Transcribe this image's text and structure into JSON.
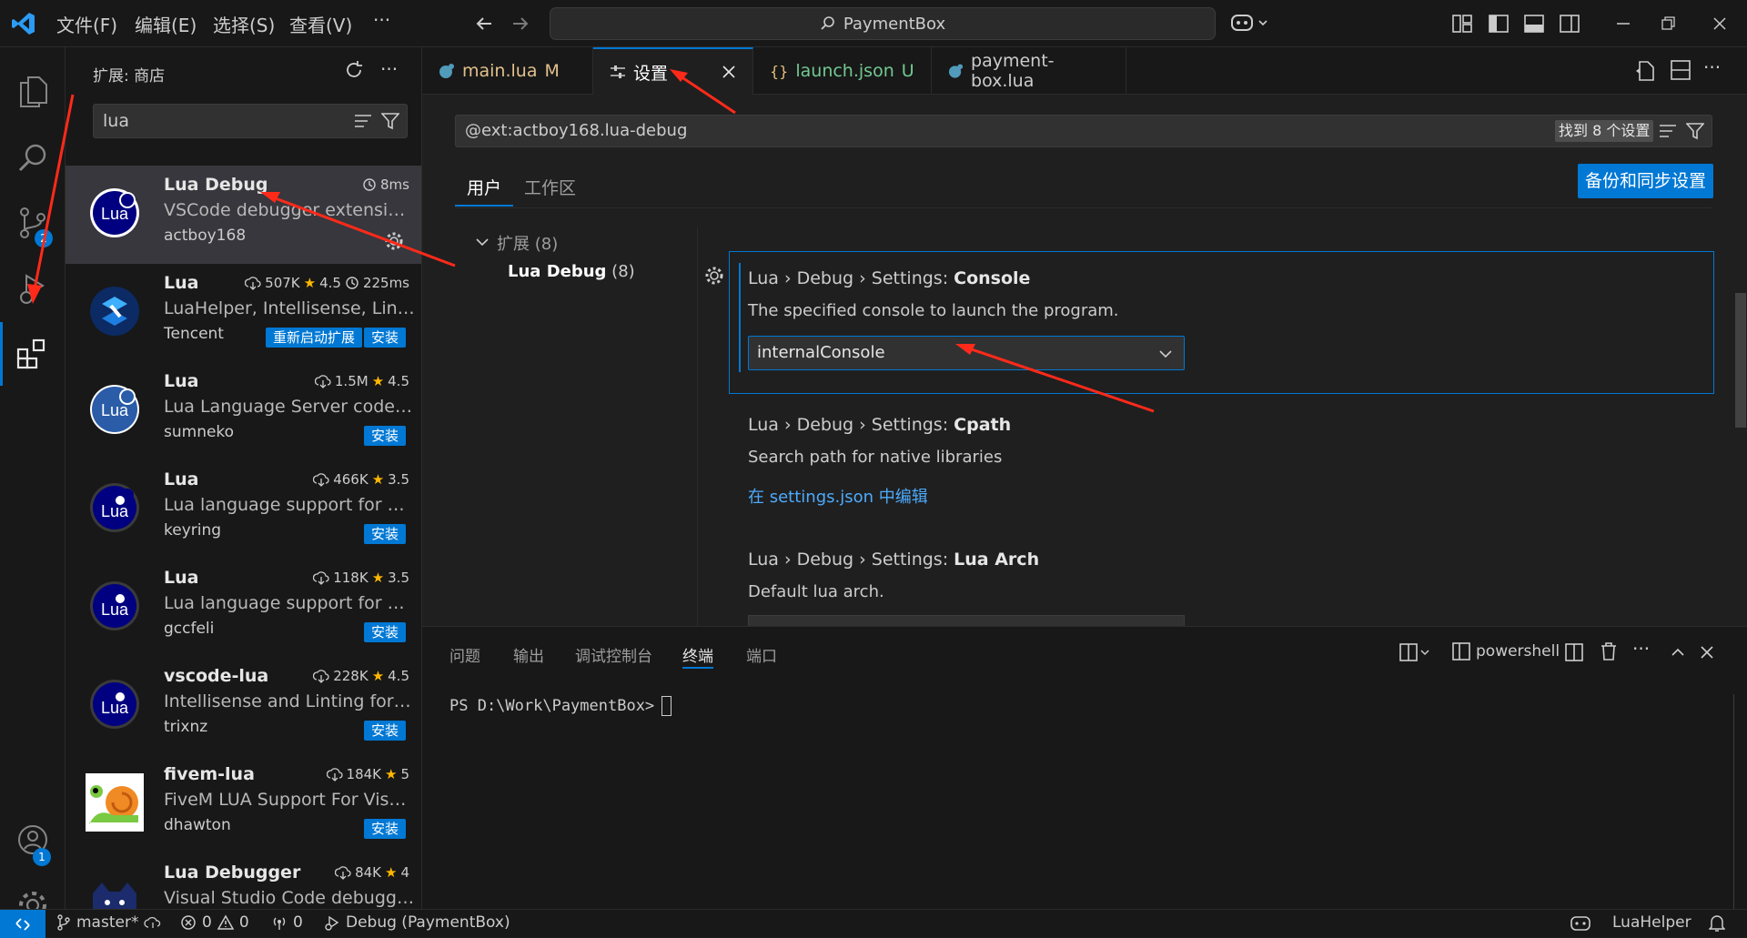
{
  "titlebar": {
    "menu": [
      "文件(F)",
      "编辑(E)",
      "选择(S)",
      "查看(V)"
    ],
    "more": "···",
    "command_center": "PaymentBox"
  },
  "activity": {
    "scm_badge": "2",
    "accounts_badge": "1"
  },
  "sidebar": {
    "title": "扩展: 商店",
    "search_value": "lua",
    "extensions": [
      {
        "name": "Lua Debug",
        "desc": "VSCode debugger extension for Lua",
        "publisher": "actboy168",
        "stats": "8ms"
      },
      {
        "name": "Lua",
        "desc": "LuaHelper, Intellisense, Linting, Debugging",
        "publisher": "Tencent",
        "downloads": "507K",
        "rating": "4.5",
        "time": "225ms",
        "restart": "重新启动扩展",
        "install": "安装"
      },
      {
        "name": "Lua",
        "desc": "Lua Language Server coded by Lua",
        "publisher": "sumneko",
        "downloads": "1.5M",
        "rating": "4.5",
        "install": "安装"
      },
      {
        "name": "Lua",
        "desc": "Lua language support for Visual Studio Code",
        "publisher": "keyring",
        "downloads": "466K",
        "rating": "3.5",
        "install": "安装"
      },
      {
        "name": "Lua",
        "desc": "Lua language support for VS Code",
        "publisher": "gccfeli",
        "downloads": "118K",
        "rating": "3.5",
        "install": "安装"
      },
      {
        "name": "vscode-lua",
        "desc": "Intellisense and Linting for Lua",
        "publisher": "trixnz",
        "downloads": "228K",
        "rating": "4.5",
        "install": "安装"
      },
      {
        "name": "fivem-lua",
        "desc": "FiveM LUA Support For Visual Studio Code",
        "publisher": "dhawton",
        "downloads": "184K",
        "rating": "5",
        "install": "安装"
      },
      {
        "name": "Lua Debugger",
        "desc": "Visual Studio Code debugger extension",
        "downloads": "84K",
        "rating": "4"
      }
    ],
    "lua_logo_text": "Lua"
  },
  "tabs": [
    {
      "label": "main.lua",
      "status": "M"
    },
    {
      "label": "设置"
    },
    {
      "label": "launch.json",
      "status": "U"
    },
    {
      "label": "payment-box.lua"
    }
  ],
  "settings": {
    "query": "@ext:actboy168.lua-debug",
    "found": "找到 8 个设置",
    "scope_tabs": [
      "用户",
      "工作区"
    ],
    "sync_button": "备份和同步设置",
    "toc_group": "扩展 (8)",
    "toc_item_name": "Lua Debug",
    "toc_item_count": "(8)",
    "items": [
      {
        "prefix": "Lua › Debug › Settings: ",
        "name": "Console",
        "desc": "The specified console to launch the program.",
        "value": "internalConsole"
      },
      {
        "prefix": "Lua › Debug › Settings: ",
        "name": "Cpath",
        "desc": "Search path for native libraries",
        "link": "在 settings.json 中编辑"
      },
      {
        "prefix": "Lua › Debug › Settings: ",
        "name": "Lua Arch",
        "desc": "Default lua arch."
      }
    ]
  },
  "panel": {
    "tabs": [
      "问题",
      "输出",
      "调试控制台",
      "终端",
      "端口"
    ],
    "shell": "powershell",
    "prompt": "PS D:\\Work\\PaymentBox>"
  },
  "statusbar": {
    "branch": "master*",
    "errors": "0",
    "warnings": "0",
    "ports": "0",
    "debug": "Debug (PaymentBox)",
    "right": "LuaHelper"
  },
  "colors": {
    "accent": "#0078d4",
    "link": "#4daafc",
    "annotation": "#ff2a1a"
  }
}
